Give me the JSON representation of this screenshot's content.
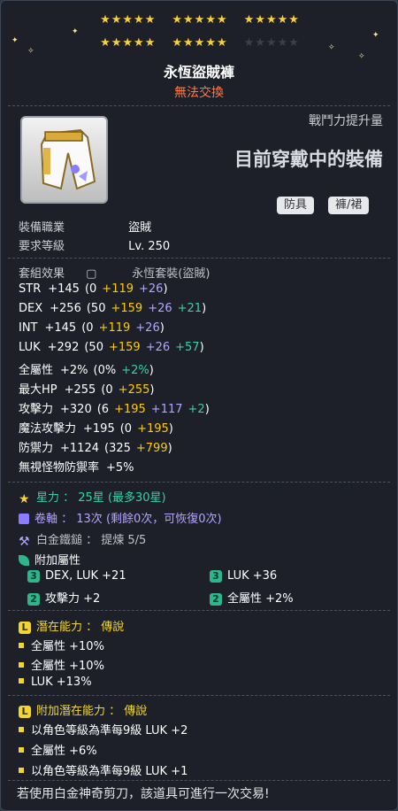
{
  "stars": {
    "row1": [
      5,
      5,
      5
    ],
    "row2": [
      5,
      5,
      5
    ],
    "filled": 25,
    "max": 30
  },
  "item": {
    "name": "永恆盜賊褲",
    "trade": "無法交換",
    "battle_power_label": "戰鬥力提升量",
    "equipped_label": "目前穿戴中的裝備",
    "tags": [
      "防具",
      "褲/裙"
    ]
  },
  "requirements": {
    "job_label": "裝備職業",
    "job": "盜賊",
    "level_label": "要求等級",
    "level": "Lv. 250"
  },
  "set": {
    "label": "套組效果",
    "value": "永恆套裝(盜賊)"
  },
  "stats": [
    {
      "name": "STR",
      "total": "+145",
      "open": "(0",
      "parts": [
        {
          "v": "+119",
          "c": "yel"
        },
        {
          "v": "+26",
          "c": "pur"
        }
      ],
      "close": ")"
    },
    {
      "name": "DEX",
      "total": "+256",
      "open": "(50",
      "parts": [
        {
          "v": "+159",
          "c": "yel"
        },
        {
          "v": "+26",
          "c": "pur"
        },
        {
          "v": "+21",
          "c": "grn"
        }
      ],
      "close": ")"
    },
    {
      "name": "INT",
      "total": "+145",
      "open": "(0",
      "parts": [
        {
          "v": "+119",
          "c": "yel"
        },
        {
          "v": "+26",
          "c": "pur"
        }
      ],
      "close": ")"
    },
    {
      "name": "LUK",
      "total": "+292",
      "open": "(50",
      "parts": [
        {
          "v": "+159",
          "c": "yel"
        },
        {
          "v": "+26",
          "c": "pur"
        },
        {
          "v": "+57",
          "c": "grn"
        }
      ],
      "close": ")"
    },
    {
      "name": "全屬性",
      "total": "+2%",
      "open": "(0%",
      "parts": [
        {
          "v": "+2%",
          "c": "grn"
        }
      ],
      "close": ")"
    },
    {
      "name": "最大HP",
      "total": "+255",
      "open": "(0",
      "parts": [
        {
          "v": "+255",
          "c": "yel"
        }
      ],
      "close": ")"
    },
    {
      "name": "攻擊力",
      "total": "+320",
      "open": "(6",
      "parts": [
        {
          "v": "+195",
          "c": "yel"
        },
        {
          "v": "+117",
          "c": "pur"
        },
        {
          "v": "+2",
          "c": "grn"
        }
      ],
      "close": ")"
    },
    {
      "name": "魔法攻擊力",
      "total": "+195",
      "open": "(0",
      "parts": [
        {
          "v": "+195",
          "c": "yel"
        }
      ],
      "close": ")"
    },
    {
      "name": "防禦力",
      "total": "+1124",
      "open": "(325",
      "parts": [
        {
          "v": "+799",
          "c": "yel"
        }
      ],
      "close": ")"
    },
    {
      "name": "無視怪物防禦率",
      "total": "+5%",
      "open": "",
      "parts": [],
      "close": ""
    }
  ],
  "enhance": {
    "starforce": "星力 ： 25星 (最多30星)",
    "scroll": "卷軸 ： 13次 (剩餘0次，可恢復0次)",
    "hammer": "白金鐵鎚 ： 提煉 5/5",
    "flame_label": "附加屬性"
  },
  "flames": [
    {
      "grade": "3",
      "text": "DEX, LUK  +21"
    },
    {
      "grade": "3",
      "text": "LUK  +36"
    },
    {
      "grade": "2",
      "text": "攻擊力 +2"
    },
    {
      "grade": "2",
      "text": "全屬性 +2%"
    }
  ],
  "potential": {
    "title": "潛在能力 ： 傳說",
    "lines": [
      "全屬性 +10%",
      "全屬性 +10%",
      "LUK +13%"
    ]
  },
  "bonus_potential": {
    "title": "附加潛在能力 ： 傳說",
    "lines": [
      "以角色等級為準每9級 LUK +2",
      "全屬性 +6%",
      "以角色等級為準每9級 LUK +1"
    ]
  },
  "footer": "若使用白金神奇剪刀，該道具可進行一次交易!",
  "colors": {
    "accent": "#ffcc00",
    "starforce": "#33d3a6",
    "scroll": "#b6a4ff",
    "trade": "#ff7a42",
    "potential": "#f2d52e"
  }
}
